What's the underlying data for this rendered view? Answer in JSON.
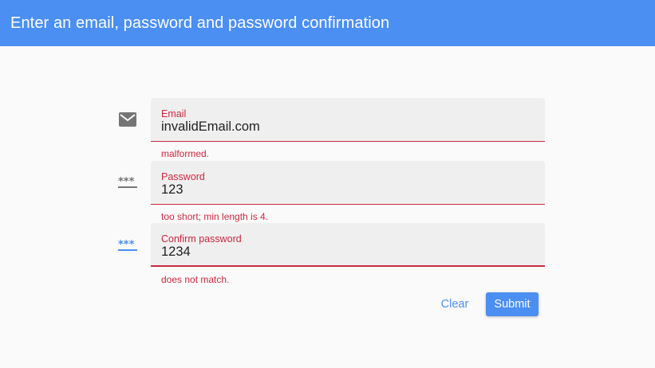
{
  "app_bar": {
    "title": "Enter an email, password and password confirmation",
    "color": "#4a8ff1"
  },
  "form": {
    "email": {
      "icon": "email-icon",
      "label": "Email",
      "value": "invalidEmail.com",
      "error": "malformed."
    },
    "password": {
      "icon": "password-icon",
      "label": "Password",
      "value": "123",
      "error": "too short; min length is 4."
    },
    "confirm_password": {
      "icon": "password-icon",
      "label": "Confirm password",
      "value": "1234",
      "error": "does not match."
    }
  },
  "actions": {
    "clear_label": "Clear",
    "submit_label": "Submit"
  },
  "colors": {
    "accent": "#4a8ff1",
    "error": "#c9283e",
    "field_bg": "#f0efef"
  }
}
